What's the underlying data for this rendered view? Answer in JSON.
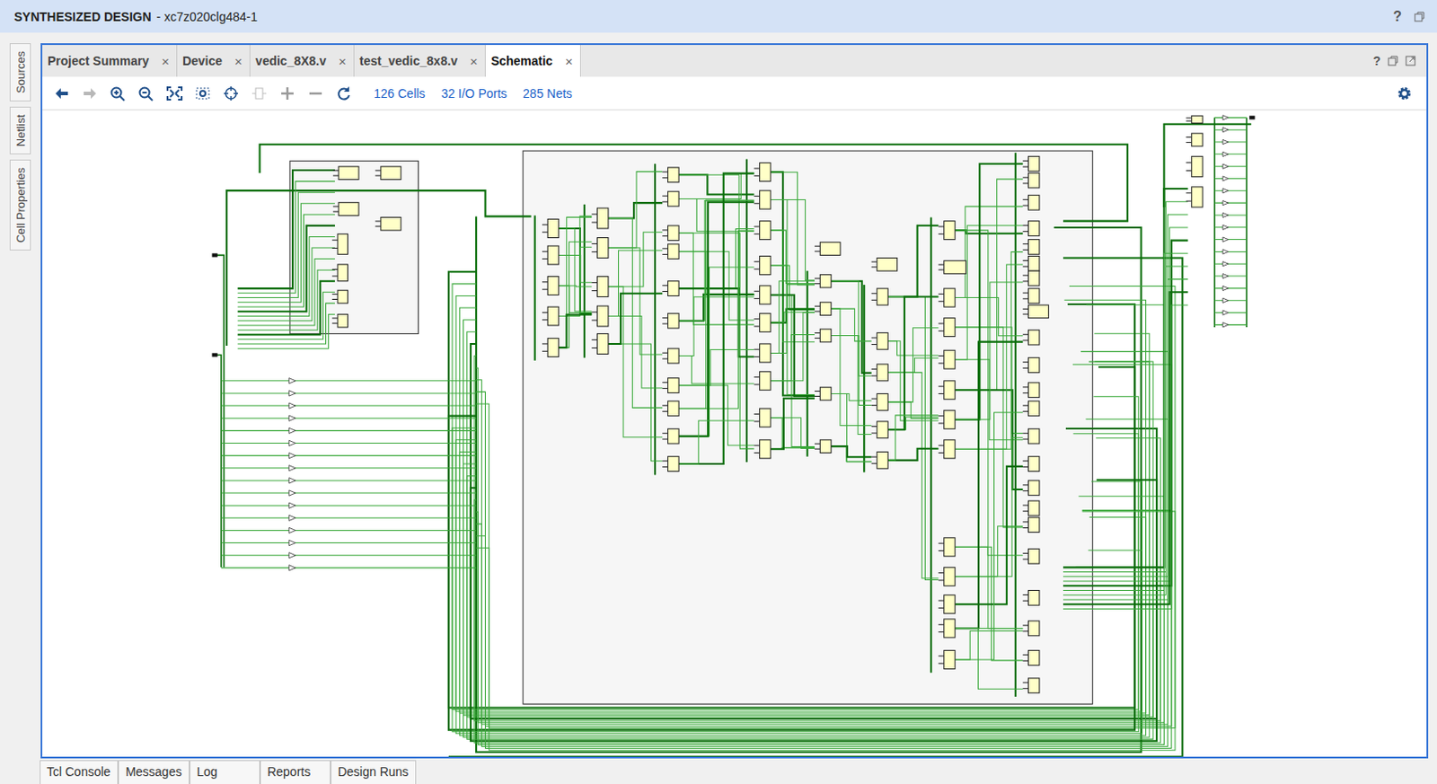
{
  "window": {
    "title": "SYNTHESIZED DESIGN",
    "subtitle": "- xc7z020clg484-1",
    "help": "?"
  },
  "side_tabs": [
    {
      "label": "Sources",
      "selected": false
    },
    {
      "label": "Netlist",
      "selected": false
    },
    {
      "label": "Cell Properties",
      "selected": false
    }
  ],
  "tabs": [
    {
      "label": "Project Summary",
      "selected": false,
      "close": "×"
    },
    {
      "label": "Device",
      "selected": false,
      "close": "×"
    },
    {
      "label": "vedic_8X8.v",
      "selected": false,
      "close": "×"
    },
    {
      "label": "test_vedic_8x8.v",
      "selected": false,
      "close": "×"
    },
    {
      "label": "Schematic",
      "selected": true,
      "close": "×"
    }
  ],
  "panel_help": "?",
  "toolbar": {
    "stats": [
      "126 Cells",
      "32 I/O Ports",
      "285 Nets"
    ]
  },
  "bottom_tabs": [
    {
      "label": "Tcl Console",
      "selected": false
    },
    {
      "label": "Messages",
      "selected": false
    },
    {
      "label": "Log",
      "selected": false
    },
    {
      "label": "Reports",
      "selected": false
    },
    {
      "label": "Design Runs",
      "selected": false
    }
  ]
}
